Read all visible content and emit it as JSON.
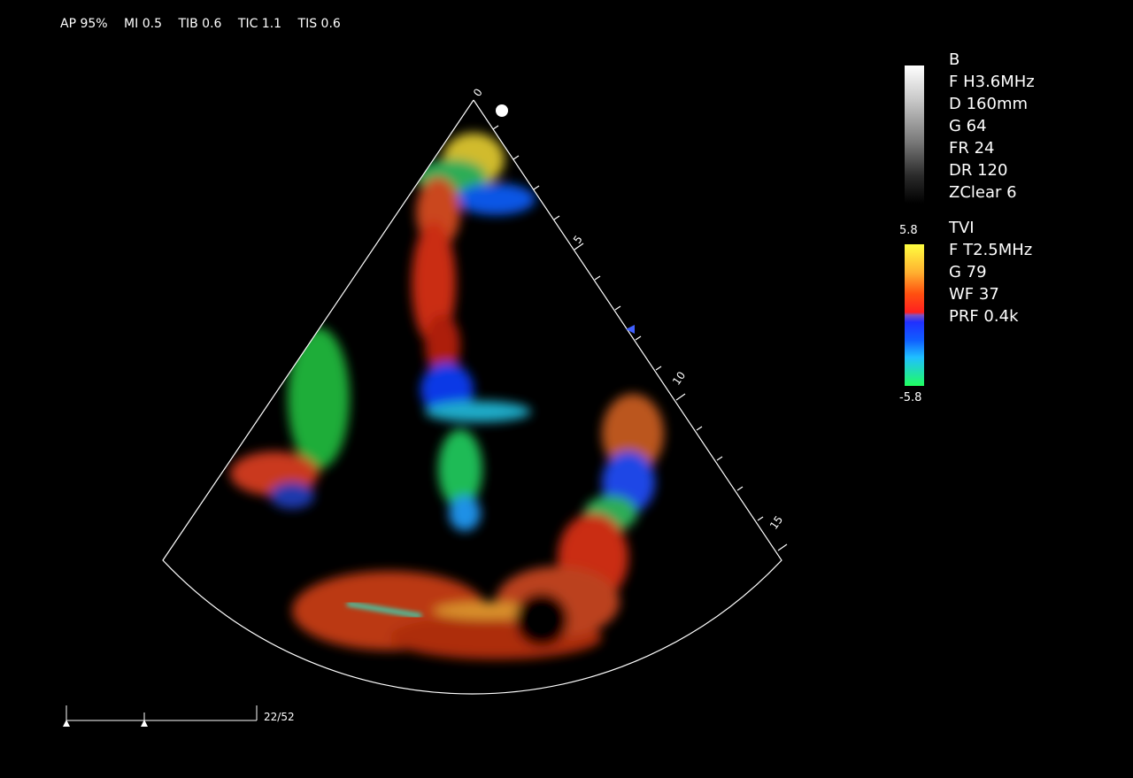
{
  "top_bar": {
    "ap": "AP 95%",
    "mi": "MI 0.5",
    "tib": "TIB 0.6",
    "tic": "TIC 1.1",
    "tis": "TIS 0.6"
  },
  "b_mode": {
    "items": [
      "B",
      "F H3.6MHz",
      "D 160mm",
      "G 64",
      "FR 24",
      "DR 120",
      "ZClear 6"
    ]
  },
  "tvi": {
    "scale_max": "5.8",
    "scale_min": "-5.8",
    "items": [
      "TVI",
      "F T2.5MHz",
      "G 79",
      "WF 37",
      "PRF 0.4k"
    ]
  },
  "depth_scale": {
    "labels": [
      "0",
      "5",
      "10",
      "15"
    ]
  },
  "cine": {
    "counter": "22/52"
  },
  "colors": {
    "background": "#000000",
    "text": "#ffffff",
    "sector_line": "#ffffff",
    "depth_marker": "#4060ff"
  }
}
